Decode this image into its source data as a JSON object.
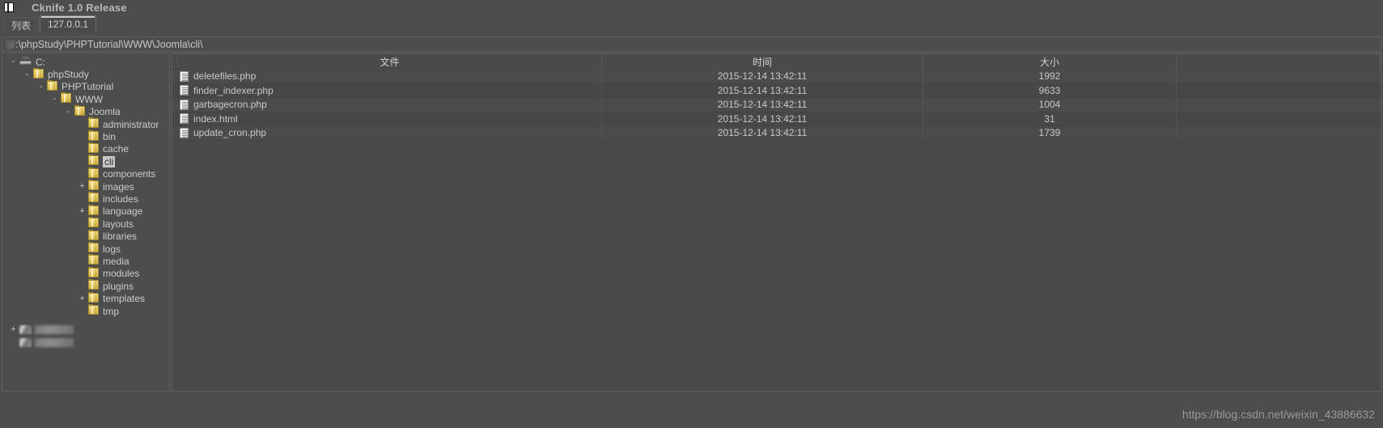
{
  "window": {
    "title": "Cknife 1.0 Release",
    "app_icon": "app-window-icon"
  },
  "tabs": [
    {
      "label": "列表",
      "active": false
    },
    {
      "label": "127.0.0.1",
      "active": true
    }
  ],
  "address_bar": {
    "value": ":\\phpStudy\\PHPTutorial\\WWW\\Joomla\\cli\\",
    "placeholder": ""
  },
  "tree": {
    "nodes": [
      {
        "label": "C:",
        "depth": 0,
        "icon": "drive-icon",
        "expander": "-",
        "selected": false
      },
      {
        "label": "phpStudy",
        "depth": 1,
        "icon": "folder-icon",
        "expander": "-",
        "selected": false
      },
      {
        "label": "PHPTutorial",
        "depth": 2,
        "icon": "folder-icon",
        "expander": "-",
        "selected": false
      },
      {
        "label": "WWW",
        "depth": 3,
        "icon": "folder-icon",
        "expander": "-",
        "selected": false
      },
      {
        "label": "Joomla",
        "depth": 4,
        "icon": "folder-icon",
        "expander": "-",
        "selected": false
      },
      {
        "label": "administrator",
        "depth": 5,
        "icon": "folder-icon",
        "expander": "",
        "selected": false
      },
      {
        "label": "bin",
        "depth": 5,
        "icon": "folder-icon",
        "expander": "",
        "selected": false
      },
      {
        "label": "cache",
        "depth": 5,
        "icon": "folder-icon",
        "expander": "",
        "selected": false
      },
      {
        "label": "cli",
        "depth": 5,
        "icon": "folder-icon",
        "expander": "",
        "selected": true
      },
      {
        "label": "components",
        "depth": 5,
        "icon": "folder-icon",
        "expander": "",
        "selected": false
      },
      {
        "label": "images",
        "depth": 5,
        "icon": "folder-icon",
        "expander": "+",
        "selected": false
      },
      {
        "label": "includes",
        "depth": 5,
        "icon": "folder-icon",
        "expander": "",
        "selected": false
      },
      {
        "label": "language",
        "depth": 5,
        "icon": "folder-icon",
        "expander": "+",
        "selected": false
      },
      {
        "label": "layouts",
        "depth": 5,
        "icon": "folder-icon",
        "expander": "",
        "selected": false
      },
      {
        "label": "libraries",
        "depth": 5,
        "icon": "folder-icon",
        "expander": "",
        "selected": false
      },
      {
        "label": "logs",
        "depth": 5,
        "icon": "folder-icon",
        "expander": "",
        "selected": false
      },
      {
        "label": "media",
        "depth": 5,
        "icon": "folder-icon",
        "expander": "",
        "selected": false
      },
      {
        "label": "modules",
        "depth": 5,
        "icon": "folder-icon",
        "expander": "",
        "selected": false
      },
      {
        "label": "plugins",
        "depth": 5,
        "icon": "folder-icon",
        "expander": "",
        "selected": false
      },
      {
        "label": "templates",
        "depth": 5,
        "icon": "folder-icon",
        "expander": "+",
        "selected": false
      },
      {
        "label": "tmp",
        "depth": 5,
        "icon": "folder-icon",
        "expander": "",
        "selected": false
      }
    ],
    "redacted_nodes": [
      {
        "depth": 0,
        "icon": "drive-icon",
        "expander": "+"
      },
      {
        "depth": 0,
        "icon": "drive-icon",
        "expander": ""
      }
    ]
  },
  "file_list": {
    "columns": [
      "文件",
      "时间",
      "大小"
    ],
    "rows": [
      {
        "name": "deletefiles.php",
        "time": "2015-12-14 13:42:11",
        "size": "1992"
      },
      {
        "name": "finder_indexer.php",
        "time": "2015-12-14 13:42:11",
        "size": "9633"
      },
      {
        "name": "garbagecron.php",
        "time": "2015-12-14 13:42:11",
        "size": "1004"
      },
      {
        "name": "index.html",
        "time": "2015-12-14 13:42:11",
        "size": "31"
      },
      {
        "name": "update_cron.php",
        "time": "2015-12-14 13:42:11",
        "size": "1739"
      }
    ]
  },
  "watermark": {
    "text": "https://blog.csdn.net/weixin_43886632"
  },
  "colors": {
    "window_bg": "#4d4d4d",
    "list_bg": "#4a4a4a",
    "text": "#c9c9c9",
    "selection_bg": "#c8c8c8",
    "folder_yellow": "#e3c660"
  }
}
